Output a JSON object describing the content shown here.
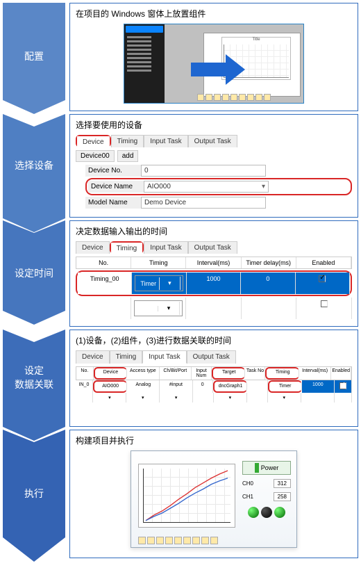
{
  "steps": {
    "s1": {
      "label": "配置",
      "title": "在项目的 Windows 窗体上放置组件",
      "graph_title": "Title",
      "color": "#5a87c7"
    },
    "s2": {
      "label": "选择设备",
      "title": "选择要使用的设备",
      "color": "#4f7fc3",
      "tabs": [
        "Device",
        "Timing",
        "Input Task",
        "Output Task"
      ],
      "device_row": "Device00",
      "add_btn": "add",
      "fields": {
        "no_label": "Device No.",
        "no_val": "0",
        "name_label": "Device Name",
        "name_val": "AIO000",
        "model_label": "Model Name",
        "model_val": "Demo Device"
      }
    },
    "s3": {
      "label": "设定时间",
      "title": "决定数据输入输出的时间",
      "color": "#4676be",
      "tabs": [
        "Device",
        "Timing",
        "Input Task",
        "Output Task"
      ],
      "cols": [
        "No.",
        "Timing",
        "Interval(ms)",
        "Timer delay(ms)",
        "Enabled"
      ],
      "row0": {
        "no": "Timing_00",
        "timing": "Timer",
        "interval": "1000",
        "delay": "0",
        "enabled": true
      },
      "row1": {
        "enabled": false
      }
    },
    "s4": {
      "label": "设定\n数据关联",
      "title": "(1)设备，(2)组件，(3)进行数据关联的时间",
      "color": "#3d6db9",
      "tabs": [
        "Device",
        "Timing",
        "Input Task",
        "Output Task"
      ],
      "cols": [
        "No.",
        "Device",
        "Access type",
        "Ch/Bit/Port",
        "Input Num",
        "Target",
        "Task No",
        "Timing",
        "Interval(ms)",
        "Enabled"
      ],
      "row": {
        "no": "IN_0",
        "device": "AIO000",
        "access": "Analog",
        "chbit": "#input",
        "num": "0",
        "target": "dncGraph1",
        "taskno": "",
        "timing": "Timer",
        "interval": "1000",
        "enabled": true
      }
    },
    "s5": {
      "label": "执行",
      "title": "构建项目并执行",
      "color": "#3463b3",
      "power": "Power",
      "ch0_label": "CH0",
      "ch0_val": "312",
      "ch1_label": "CH1",
      "ch1_val": "258"
    }
  },
  "chart_data": {
    "type": "line",
    "title": "Title",
    "series": [
      {
        "name": "CH0",
        "color": "#d33",
        "x": [
          0,
          1,
          2,
          3,
          4,
          5,
          6,
          7,
          8,
          9,
          10
        ],
        "y": [
          0,
          30,
          55,
          90,
          130,
          160,
          200,
          230,
          265,
          290,
          312
        ]
      },
      {
        "name": "CH1",
        "color": "#36c",
        "x": [
          0,
          1,
          2,
          3,
          4,
          5,
          6,
          7,
          8,
          9,
          10
        ],
        "y": [
          0,
          25,
          45,
          75,
          105,
          135,
          165,
          190,
          218,
          240,
          258
        ]
      }
    ],
    "xlim": [
      0,
      10
    ],
    "ylim": [
      0,
      320
    ]
  }
}
